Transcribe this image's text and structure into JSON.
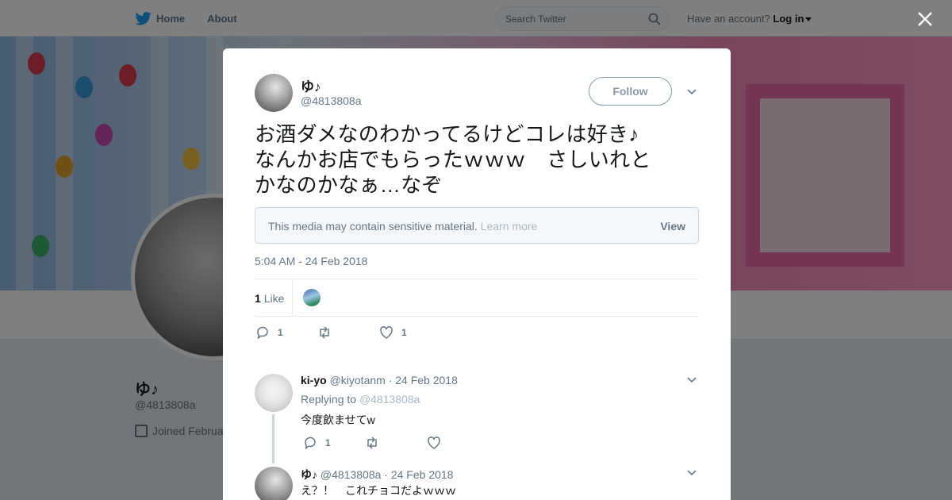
{
  "nav": {
    "home": "Home",
    "about": "About"
  },
  "search": {
    "placeholder": "Search Twitter"
  },
  "account": {
    "prompt": "Have an account?",
    "login": "Log in"
  },
  "profile": {
    "name": "ゆ♪",
    "handle": "@4813808a",
    "joined": "Joined Februa"
  },
  "tweet": {
    "name": "ゆ♪",
    "handle": "@4813808a",
    "follow_label": "Follow",
    "text_lines": [
      "お酒ダメなのわかってるけどコレは好き♪",
      "なんかお店でもらったｗｗｗ　さしいれと",
      "かなのかなぁ…なぞ"
    ],
    "sensitive_text": "This media may contain sensitive material.",
    "learn_more": "Learn more",
    "view_label": "View",
    "timestamp": "5:04 AM - 24 Feb 2018",
    "like_count": "1",
    "like_word": "Like",
    "reply_count": "1",
    "fav_count": "1"
  },
  "replies": [
    {
      "name": "ki-yo",
      "handle": "@kiyotanm",
      "date": "· 24 Feb 2018",
      "replying_prefix": "Replying to",
      "replying_to": "@4813808a",
      "text": "今度飲ませてw",
      "reply_count": "1"
    },
    {
      "name": "ゆ♪",
      "handle": "@4813808a",
      "date": "· 24 Feb 2018",
      "text": "え？！　これチョコだよｗｗｗ"
    }
  ],
  "colors": {
    "brand": "#1da1f2",
    "muted": "#657786",
    "border": "#e6ecf0"
  },
  "icons": [
    "twitter-bird-icon",
    "search-icon",
    "close-icon",
    "chevron-down-icon",
    "reply-icon",
    "retweet-icon",
    "heart-icon",
    "calendar-icon"
  ]
}
